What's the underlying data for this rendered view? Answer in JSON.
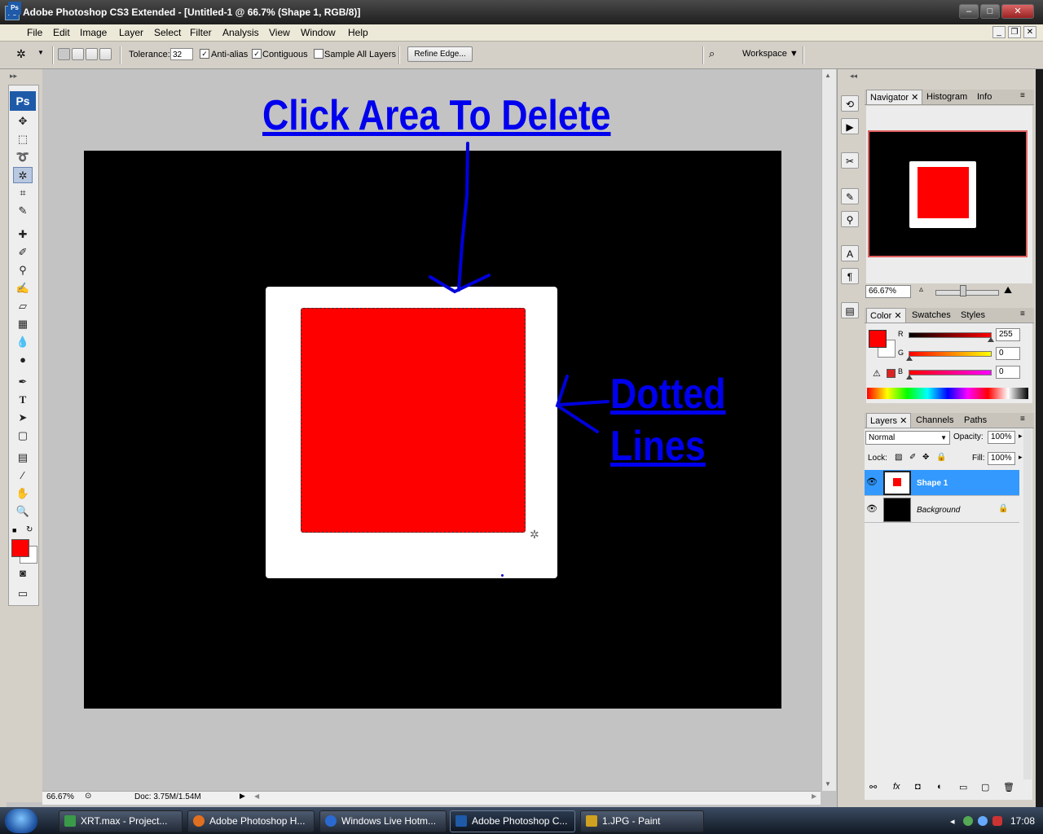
{
  "window": {
    "title": "Adobe Photoshop CS3 Extended - [Untitled-1 @ 66.7% (Shape 1, RGB/8)]",
    "app_icon": "Ps"
  },
  "menu": [
    "File",
    "Edit",
    "Image",
    "Layer",
    "Select",
    "Filter",
    "Analysis",
    "View",
    "Window",
    "Help"
  ],
  "options": {
    "tolerance_label": "Tolerance:",
    "tolerance_value": "32",
    "antialias_label": "Anti-alias",
    "antialias_checked": "✓",
    "contiguous_label": "Contiguous",
    "contiguous_checked": "✓",
    "sample_all_label": "Sample All Layers",
    "refine_edge_label": "Refine Edge...",
    "workspace_label": "Workspace ▼"
  },
  "toolbox": {
    "logo": "Ps",
    "tools": [
      "move-tool-icon",
      "marquee-tool-icon",
      "lasso-tool-icon",
      "magic-wand-tool-icon",
      "crop-tool-icon",
      "slice-tool-icon",
      "healing-brush-icon",
      "brush-tool-icon",
      "clone-stamp-icon",
      "history-brush-icon",
      "eraser-tool-icon",
      "gradient-tool-icon",
      "blur-tool-icon",
      "dodge-tool-icon",
      "pen-tool-icon",
      "type-tool-icon",
      "path-selection-icon",
      "shape-tool-icon",
      "notes-tool-icon",
      "eyedropper-tool-icon",
      "hand-tool-icon",
      "zoom-tool-icon"
    ],
    "foreground_color": "#ff0000",
    "background_color": "#ffffff"
  },
  "annotations": {
    "click_area": "Click Area To Delete",
    "dotted": "Dotted",
    "lines": "Lines"
  },
  "status": {
    "zoom": "66.67%",
    "doc": "Doc: 3.75M/1.54M"
  },
  "navigator": {
    "tabs": [
      "Navigator",
      "Histogram",
      "Info"
    ],
    "zoom": "66.67%"
  },
  "color_panel": {
    "tabs": [
      "Color",
      "Swatches",
      "Styles"
    ],
    "r_label": "R",
    "r_value": "255",
    "g_label": "G",
    "g_value": "0",
    "b_label": "B",
    "b_value": "0"
  },
  "layers_panel": {
    "tabs": [
      "Layers",
      "Channels",
      "Paths"
    ],
    "blend_mode": "Normal",
    "opacity_label": "Opacity:",
    "opacity_value": "100%",
    "lock_label": "Lock:",
    "fill_label": "Fill:",
    "fill_value": "100%",
    "layers": [
      {
        "name": "Shape 1",
        "selected": true
      },
      {
        "name": "Background",
        "selected": false
      }
    ]
  },
  "taskbar": {
    "items": [
      {
        "label": "XRT.max    - Project...",
        "icon_color": "#3a9a4a"
      },
      {
        "label": "Adobe Photoshop H...",
        "icon_color": "#e07020"
      },
      {
        "label": "Windows Live Hotm...",
        "icon_color": "#2a6ad0"
      },
      {
        "label": "Adobe Photoshop C...",
        "icon_color": "#1e5aa8"
      },
      {
        "label": "1.JPG - Paint",
        "icon_color": "#d0a020"
      }
    ],
    "clock": "17:08"
  },
  "colors": {
    "accent_selected": "#3399ff",
    "annotation_blue": "#0000ee"
  }
}
